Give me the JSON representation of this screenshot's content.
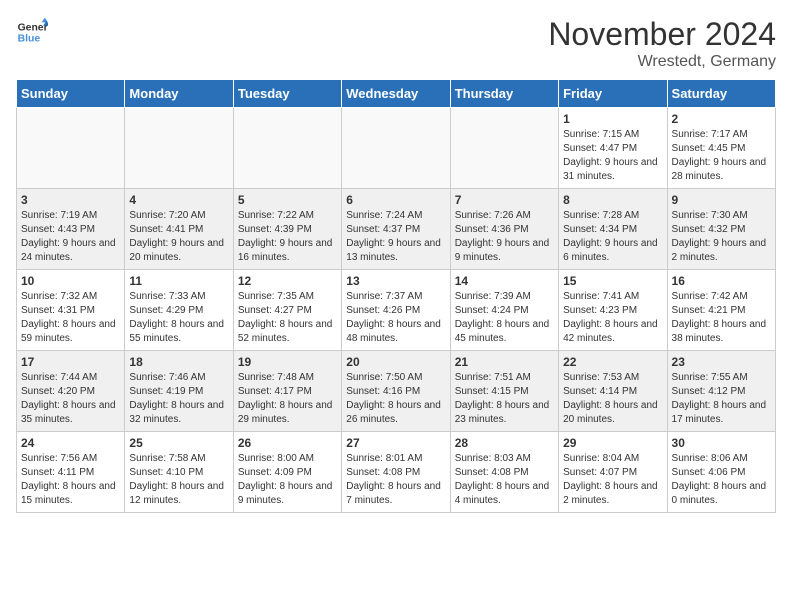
{
  "logo": {
    "line1": "General",
    "line2": "Blue"
  },
  "title": "November 2024",
  "location": "Wrestedt, Germany",
  "weekdays": [
    "Sunday",
    "Monday",
    "Tuesday",
    "Wednesday",
    "Thursday",
    "Friday",
    "Saturday"
  ],
  "weeks": [
    [
      {
        "day": "",
        "info": ""
      },
      {
        "day": "",
        "info": ""
      },
      {
        "day": "",
        "info": ""
      },
      {
        "day": "",
        "info": ""
      },
      {
        "day": "",
        "info": ""
      },
      {
        "day": "1",
        "info": "Sunrise: 7:15 AM\nSunset: 4:47 PM\nDaylight: 9 hours and 31 minutes."
      },
      {
        "day": "2",
        "info": "Sunrise: 7:17 AM\nSunset: 4:45 PM\nDaylight: 9 hours and 28 minutes."
      }
    ],
    [
      {
        "day": "3",
        "info": "Sunrise: 7:19 AM\nSunset: 4:43 PM\nDaylight: 9 hours and 24 minutes."
      },
      {
        "day": "4",
        "info": "Sunrise: 7:20 AM\nSunset: 4:41 PM\nDaylight: 9 hours and 20 minutes."
      },
      {
        "day": "5",
        "info": "Sunrise: 7:22 AM\nSunset: 4:39 PM\nDaylight: 9 hours and 16 minutes."
      },
      {
        "day": "6",
        "info": "Sunrise: 7:24 AM\nSunset: 4:37 PM\nDaylight: 9 hours and 13 minutes."
      },
      {
        "day": "7",
        "info": "Sunrise: 7:26 AM\nSunset: 4:36 PM\nDaylight: 9 hours and 9 minutes."
      },
      {
        "day": "8",
        "info": "Sunrise: 7:28 AM\nSunset: 4:34 PM\nDaylight: 9 hours and 6 minutes."
      },
      {
        "day": "9",
        "info": "Sunrise: 7:30 AM\nSunset: 4:32 PM\nDaylight: 9 hours and 2 minutes."
      }
    ],
    [
      {
        "day": "10",
        "info": "Sunrise: 7:32 AM\nSunset: 4:31 PM\nDaylight: 8 hours and 59 minutes."
      },
      {
        "day": "11",
        "info": "Sunrise: 7:33 AM\nSunset: 4:29 PM\nDaylight: 8 hours and 55 minutes."
      },
      {
        "day": "12",
        "info": "Sunrise: 7:35 AM\nSunset: 4:27 PM\nDaylight: 8 hours and 52 minutes."
      },
      {
        "day": "13",
        "info": "Sunrise: 7:37 AM\nSunset: 4:26 PM\nDaylight: 8 hours and 48 minutes."
      },
      {
        "day": "14",
        "info": "Sunrise: 7:39 AM\nSunset: 4:24 PM\nDaylight: 8 hours and 45 minutes."
      },
      {
        "day": "15",
        "info": "Sunrise: 7:41 AM\nSunset: 4:23 PM\nDaylight: 8 hours and 42 minutes."
      },
      {
        "day": "16",
        "info": "Sunrise: 7:42 AM\nSunset: 4:21 PM\nDaylight: 8 hours and 38 minutes."
      }
    ],
    [
      {
        "day": "17",
        "info": "Sunrise: 7:44 AM\nSunset: 4:20 PM\nDaylight: 8 hours and 35 minutes."
      },
      {
        "day": "18",
        "info": "Sunrise: 7:46 AM\nSunset: 4:19 PM\nDaylight: 8 hours and 32 minutes."
      },
      {
        "day": "19",
        "info": "Sunrise: 7:48 AM\nSunset: 4:17 PM\nDaylight: 8 hours and 29 minutes."
      },
      {
        "day": "20",
        "info": "Sunrise: 7:50 AM\nSunset: 4:16 PM\nDaylight: 8 hours and 26 minutes."
      },
      {
        "day": "21",
        "info": "Sunrise: 7:51 AM\nSunset: 4:15 PM\nDaylight: 8 hours and 23 minutes."
      },
      {
        "day": "22",
        "info": "Sunrise: 7:53 AM\nSunset: 4:14 PM\nDaylight: 8 hours and 20 minutes."
      },
      {
        "day": "23",
        "info": "Sunrise: 7:55 AM\nSunset: 4:12 PM\nDaylight: 8 hours and 17 minutes."
      }
    ],
    [
      {
        "day": "24",
        "info": "Sunrise: 7:56 AM\nSunset: 4:11 PM\nDaylight: 8 hours and 15 minutes."
      },
      {
        "day": "25",
        "info": "Sunrise: 7:58 AM\nSunset: 4:10 PM\nDaylight: 8 hours and 12 minutes."
      },
      {
        "day": "26",
        "info": "Sunrise: 8:00 AM\nSunset: 4:09 PM\nDaylight: 8 hours and 9 minutes."
      },
      {
        "day": "27",
        "info": "Sunrise: 8:01 AM\nSunset: 4:08 PM\nDaylight: 8 hours and 7 minutes."
      },
      {
        "day": "28",
        "info": "Sunrise: 8:03 AM\nSunset: 4:08 PM\nDaylight: 8 hours and 4 minutes."
      },
      {
        "day": "29",
        "info": "Sunrise: 8:04 AM\nSunset: 4:07 PM\nDaylight: 8 hours and 2 minutes."
      },
      {
        "day": "30",
        "info": "Sunrise: 8:06 AM\nSunset: 4:06 PM\nDaylight: 8 hours and 0 minutes."
      }
    ]
  ]
}
